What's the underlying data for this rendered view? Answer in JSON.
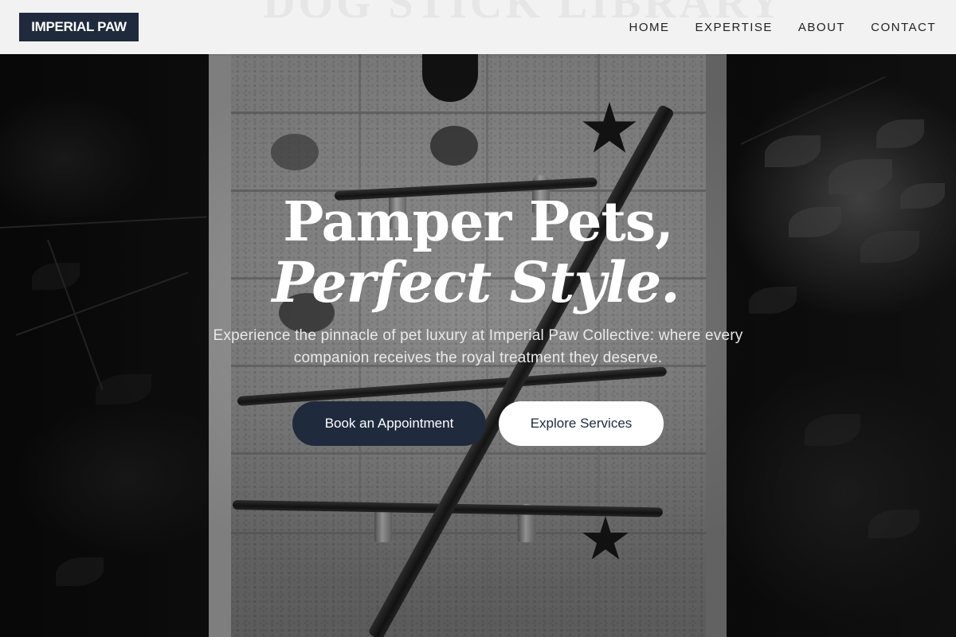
{
  "brand": {
    "name": "IMPERIAL PAW",
    "bg_color": "#1f2a3d"
  },
  "background_sign": "DOG STICK LIBRARY",
  "nav": {
    "items": [
      {
        "label": "HOME"
      },
      {
        "label": "EXPERTISE"
      },
      {
        "label": "ABOUT"
      },
      {
        "label": "CONTACT"
      }
    ]
  },
  "hero": {
    "title_line1": "Pamper Pets,",
    "title_line2": "Perfect Style.",
    "subtitle": "Experience the pinnacle of pet luxury at Imperial Paw Collective: where every companion receives the royal treatment they deserve.",
    "primary_button": "Book an Appointment",
    "secondary_button": "Explore Services",
    "accent_color": "#1f2a3d"
  }
}
